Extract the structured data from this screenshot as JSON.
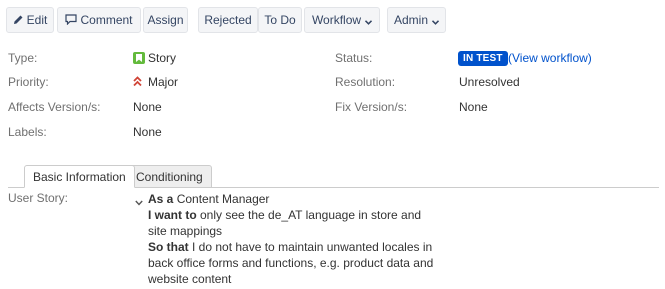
{
  "toolbar": {
    "edit_label": "Edit",
    "comment_label": "Comment",
    "assign_label": "Assign",
    "rejected_label": "Rejected",
    "todo_label": "To Do",
    "workflow_label": "Workflow",
    "admin_label": "Admin"
  },
  "details": {
    "type_label": "Type:",
    "type_value": "Story",
    "priority_label": "Priority:",
    "priority_value": "Major",
    "affects_label": "Affects Version/s:",
    "affects_value": "None",
    "labels_label": "Labels:",
    "labels_value": "None",
    "status_label": "Status:",
    "status_value": "IN TEST",
    "view_workflow": "(View workflow)",
    "resolution_label": "Resolution:",
    "resolution_value": "Unresolved",
    "fix_label": "Fix Version/s:",
    "fix_value": "None"
  },
  "tabs": [
    {
      "label": "Basic Information",
      "active": true
    },
    {
      "label": "Conditioning",
      "active": false
    }
  ],
  "user_story": {
    "label": "User Story:",
    "as_a_kw": "As a",
    "as_a_text": " Content Manager",
    "i_want_kw": "I want to",
    "i_want_text": " only see the de_AT language in store and site mappings",
    "so_that_kw": "So that",
    "so_that_text": " I do not have to maintain unwanted locales in back office forms and functions, e.g. product data and website content"
  },
  "colors": {
    "status_blue": "#0052cc",
    "story_green": "#63ba3c",
    "priority_red": "#d04437"
  },
  "icons": [
    "pencil-icon",
    "comment-icon",
    "chevron-down-icon",
    "story-icon",
    "priority-major-icon"
  ]
}
